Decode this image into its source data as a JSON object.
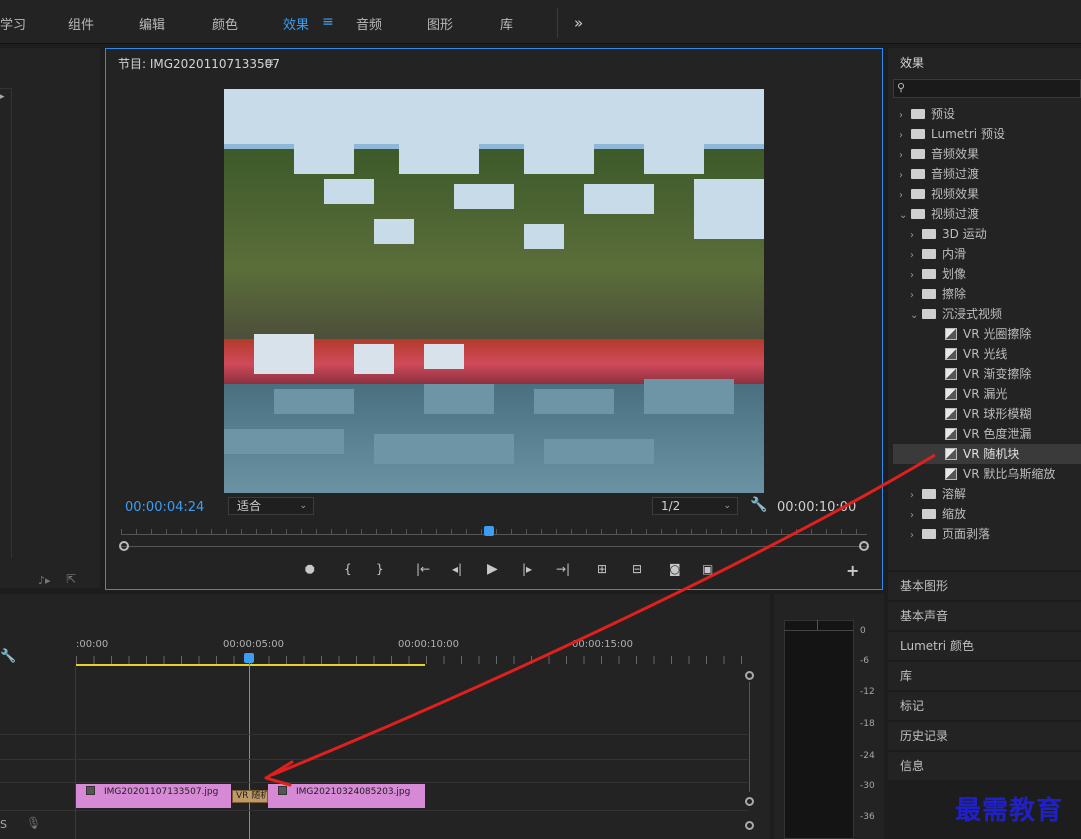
{
  "topbar": {
    "tabs": [
      "学习",
      "组件",
      "编辑",
      "颜色",
      "效果",
      "音频",
      "图形",
      "库"
    ],
    "active": "效果",
    "more": "»"
  },
  "program": {
    "title": "节目: IMG20201107133507",
    "menu": "≡",
    "timecode": "00:00:04:24",
    "fit": "适合",
    "resolution": "1/2",
    "duration": "00:00:10:00"
  },
  "effects": {
    "title": "效果",
    "search_placeholder": "",
    "tree": [
      {
        "label": "预设",
        "level": 0,
        "type": "folder-star",
        "open": false
      },
      {
        "label": "Lumetri 预设",
        "level": 0,
        "type": "folder-star",
        "open": false
      },
      {
        "label": "音频效果",
        "level": 0,
        "type": "folder",
        "open": false
      },
      {
        "label": "音频过渡",
        "level": 0,
        "type": "folder",
        "open": false
      },
      {
        "label": "视频效果",
        "level": 0,
        "type": "folder",
        "open": false
      },
      {
        "label": "视频过渡",
        "level": 0,
        "type": "folder",
        "open": true
      },
      {
        "label": "3D 运动",
        "level": 1,
        "type": "folder",
        "open": false
      },
      {
        "label": "内滑",
        "level": 1,
        "type": "folder",
        "open": false
      },
      {
        "label": "划像",
        "level": 1,
        "type": "folder",
        "open": false
      },
      {
        "label": "擦除",
        "level": 1,
        "type": "folder",
        "open": false
      },
      {
        "label": "沉浸式视频",
        "level": 1,
        "type": "folder",
        "open": true
      },
      {
        "label": "VR 光圈擦除",
        "level": 2,
        "type": "fx"
      },
      {
        "label": "VR 光线",
        "level": 2,
        "type": "fx"
      },
      {
        "label": "VR 渐变擦除",
        "level": 2,
        "type": "fx"
      },
      {
        "label": "VR 漏光",
        "level": 2,
        "type": "fx"
      },
      {
        "label": "VR 球形模糊",
        "level": 2,
        "type": "fx"
      },
      {
        "label": "VR 色度泄漏",
        "level": 2,
        "type": "fx"
      },
      {
        "label": "VR 随机块",
        "level": 2,
        "type": "fx",
        "selected": true
      },
      {
        "label": "VR 默比乌斯缩放",
        "level": 2,
        "type": "fx"
      },
      {
        "label": "溶解",
        "level": 1,
        "type": "folder",
        "open": false
      },
      {
        "label": "缩放",
        "level": 1,
        "type": "folder",
        "open": false
      },
      {
        "label": "页面剥落",
        "level": 1,
        "type": "folder",
        "open": false
      }
    ]
  },
  "side_panels": [
    "基本图形",
    "基本声音",
    "Lumetri 颜色",
    "库",
    "标记",
    "历史记录",
    "信息"
  ],
  "timeline": {
    "ruler": [
      ":00:00",
      "00:00:05:00",
      "00:00:10:00",
      "00:00:15:00"
    ],
    "clips": [
      {
        "label": "IMG20201107133507.jpg"
      },
      {
        "label": "IMG20210324085203.jpg"
      }
    ],
    "transition_label": "VR 随机",
    "track_s_label": "S"
  },
  "meter": {
    "labels": [
      "0",
      "-6",
      "-12",
      "-18",
      "-24",
      "-30",
      "-36"
    ]
  },
  "watermark": "最需教育",
  "colors": {
    "accent": "#2d8ceb",
    "clip": "#d68ad6",
    "arrow": "#e0201e",
    "playhead": "#3d9df3"
  }
}
